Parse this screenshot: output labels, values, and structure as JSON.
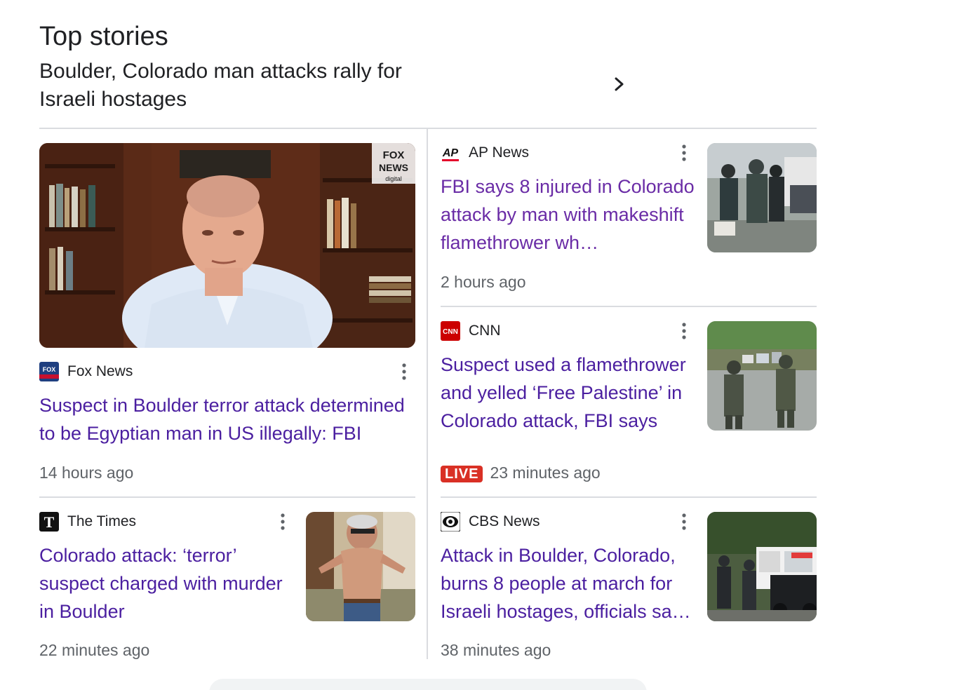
{
  "section": {
    "title": "Top stories",
    "topic": "Boulder, Colorado man attacks rally for Israeli hostages"
  },
  "stories": [
    {
      "source": "Fox News",
      "logo_text": "FOX NEWS",
      "headline": "Suspect in Boulder terror attack determined to be Egyptian man in US illegally: FBI",
      "time": "14 hours ago",
      "watermark": "FOX NEWS digital"
    },
    {
      "source": "AP News",
      "logo_text": "AP",
      "headline": "FBI says 8 injured in Colorado attack by man with makeshift flamethrower wh…",
      "time": "2 hours ago"
    },
    {
      "source": "CNN",
      "logo_text": "CNN",
      "headline": "Suspect used a flamethrower and yelled ‘Free Palestine’ in Colorado attack, FBI says",
      "live": "LIVE",
      "time": "23 minutes ago"
    },
    {
      "source": "The Times",
      "logo_text": "T",
      "headline": "Colorado attack: ‘terror’ suspect charged with murder in Boulder",
      "time": "22 minutes ago"
    },
    {
      "source": "CBS News",
      "logo_text": "CBS",
      "headline": "Attack in Boulder, Colorado, burns 8 people at march for Israeli hostages, officials sa…",
      "time": "38 minutes ago"
    }
  ],
  "colors": {
    "headline": "#4b1fa0",
    "visited_headline": "#6a2ca6",
    "meta": "#5f6368",
    "live": "#d93025",
    "divider": "#dadce0"
  },
  "icons": [
    "chevron-right-icon",
    "more-vert-icon"
  ]
}
